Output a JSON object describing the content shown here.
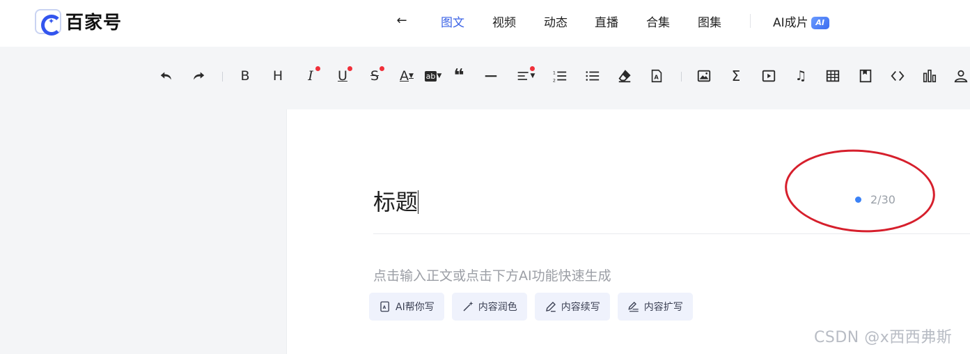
{
  "header": {
    "logo_text": "百家号",
    "nav": {
      "back_icon": "arrow-left-icon",
      "tabs": [
        {
          "label": "图文",
          "active": true
        },
        {
          "label": "视频",
          "active": false
        },
        {
          "label": "动态",
          "active": false
        },
        {
          "label": "直播",
          "active": false
        },
        {
          "label": "合集",
          "active": false
        },
        {
          "label": "图集",
          "active": false
        }
      ],
      "ai_tab": {
        "label": "AI成片",
        "badge": "AI"
      }
    }
  },
  "toolbar": {
    "items": [
      {
        "name": "undo-icon"
      },
      {
        "name": "redo-icon"
      },
      {
        "name": "bold-icon",
        "glyph": "B"
      },
      {
        "name": "heading-icon",
        "glyph": "H"
      },
      {
        "name": "italic-icon",
        "glyph": "I",
        "dot": true
      },
      {
        "name": "underline-icon",
        "glyph": "U",
        "dot": true
      },
      {
        "name": "strikethrough-icon",
        "glyph": "S",
        "dot": true
      },
      {
        "name": "font-color-icon",
        "glyph": "A"
      },
      {
        "name": "highlight-icon",
        "glyph": "ab"
      },
      {
        "name": "quote-icon",
        "glyph": "❝"
      },
      {
        "name": "divider-icon"
      },
      {
        "name": "align-icon",
        "dot": true
      },
      {
        "name": "ordered-list-icon"
      },
      {
        "name": "unordered-list-icon"
      },
      {
        "name": "eraser-icon"
      },
      {
        "name": "format-painter-icon"
      },
      {
        "name": "image-icon"
      },
      {
        "name": "formula-icon",
        "glyph": "Σ"
      },
      {
        "name": "video-icon"
      },
      {
        "name": "music-icon",
        "glyph": "♫"
      },
      {
        "name": "table-icon"
      },
      {
        "name": "bookmark-icon"
      },
      {
        "name": "code-icon"
      },
      {
        "name": "chart-icon"
      },
      {
        "name": "user-icon"
      }
    ],
    "accent_dot_color": "#f0303a"
  },
  "editor": {
    "title_value": "标题",
    "title_counter": "2/30",
    "body_placeholder": "点击输入正文或点击下方AI功能快速生成",
    "ai_buttons": [
      {
        "label": "AI帮你写",
        "icon": "ai-write-icon"
      },
      {
        "label": "内容润色",
        "icon": "magic-wand-icon"
      },
      {
        "label": "内容续写",
        "icon": "pen-icon"
      },
      {
        "label": "内容扩写",
        "icon": "pen-lines-icon"
      }
    ]
  },
  "watermark": "CSDN @x西西弗斯",
  "colors": {
    "brand": "#3b63e6",
    "annotation": "#d61f2c"
  }
}
